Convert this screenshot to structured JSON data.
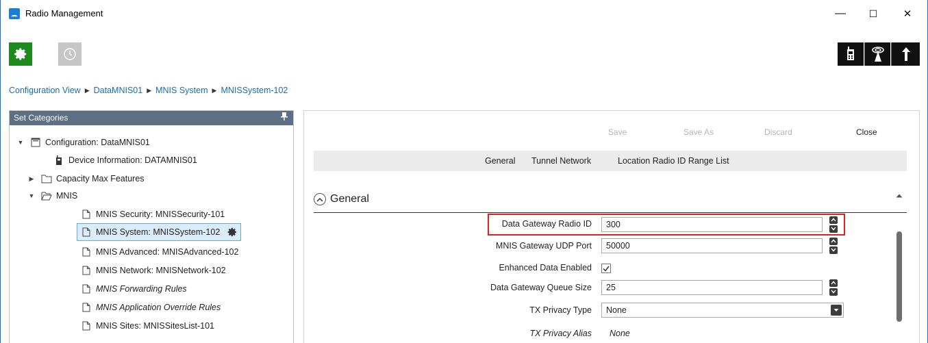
{
  "window": {
    "title": "Radio Management",
    "minimize_glyph": "—",
    "maximize_glyph": "☐",
    "close_glyph": "✕"
  },
  "toolbar": {
    "left_icons": [
      "gear-icon",
      "clock-icon"
    ],
    "right_icons": [
      "radio-device-icon",
      "repeater-tower-icon",
      "upload-arrow-icon"
    ],
    "active_color": "#1c8a1c"
  },
  "breadcrumb": [
    "Configuration View",
    "DataMNIS01",
    "MNIS System",
    "MNISSystem-102"
  ],
  "left_panel": {
    "header": "Set Categories",
    "pin_glyph": "ꟷ",
    "tree": [
      {
        "label": "Configuration: DataMNIS01",
        "icon": "configuration-icon",
        "expanded": true
      },
      {
        "label": "Device Information: DATAMNIS01",
        "icon": "device-icon"
      },
      {
        "label": "Capacity Max Features",
        "icon": "folder-icon",
        "expanded": false
      },
      {
        "label": "MNIS",
        "icon": "folder-open-icon",
        "expanded": true
      },
      {
        "label": "MNIS Security: MNISSecurity-101",
        "icon": "document-icon"
      },
      {
        "label": "MNIS System: MNISSystem-102",
        "icon": "document-icon",
        "selected": true
      },
      {
        "label": "MNIS Advanced: MNISAdvanced-102",
        "icon": "document-icon"
      },
      {
        "label": "MNIS Network: MNISNetwork-102",
        "icon": "document-icon"
      },
      {
        "label": "MNIS Forwarding Rules",
        "icon": "document-icon",
        "italic": true
      },
      {
        "label": "MNIS Application Override Rules",
        "icon": "document-icon",
        "italic": true
      },
      {
        "label": "MNIS Sites: MNISSitesList-101",
        "icon": "document-icon"
      }
    ]
  },
  "right_panel": {
    "actions": {
      "save": "Save",
      "save_as": "Save As",
      "discard": "Discard",
      "close": "Close"
    },
    "tabs": [
      "General",
      "Tunnel Network",
      "Location Radio ID Range List"
    ],
    "section_title": "General",
    "fields": {
      "data_gateway_radio_id": {
        "label": "Data Gateway Radio ID",
        "value": "300"
      },
      "mnis_gateway_udp_port": {
        "label": "MNIS Gateway UDP Port",
        "value": "50000"
      },
      "enhanced_data_enabled": {
        "label": "Enhanced Data Enabled",
        "checked": true
      },
      "data_gateway_queue_size": {
        "label": "Data Gateway Queue Size",
        "value": "25"
      },
      "tx_privacy_type": {
        "label": "TX Privacy Type",
        "value": "None"
      },
      "tx_privacy_alias": {
        "label": "TX Privacy Alias",
        "value": "None"
      }
    },
    "highlight_color": "#e02020"
  }
}
